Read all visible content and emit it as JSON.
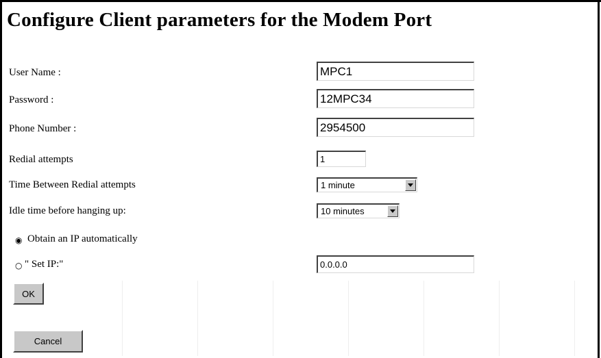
{
  "page": {
    "title": "Configure Client parameters for the Modem Port"
  },
  "form": {
    "user_name": {
      "label": "User Name :",
      "value": "MPC1"
    },
    "password": {
      "label": "Password :",
      "value": "12MPC34"
    },
    "phone_number": {
      "label": "Phone Number :",
      "value": "2954500"
    },
    "redial_attempts": {
      "label": "Redial attempts",
      "value": "1"
    },
    "time_between_redial": {
      "label": "Time Between Redial attempts",
      "selected": "1 minute"
    },
    "idle_time": {
      "label": "Idle time before hanging up:",
      "selected": "10 minutes"
    },
    "obtain_ip": {
      "label": "Obtain an IP automatically",
      "checked": true
    },
    "set_ip": {
      "label": "\" Set IP:\"",
      "value": "0.0.0.0",
      "checked": false
    }
  },
  "buttons": {
    "ok_label": "OK",
    "cancel_label": "Cancel"
  },
  "icons": {
    "radio_selected": "radio-selected-icon",
    "radio_unselected": "radio-unselected-icon",
    "dropdown_arrow": "chevron-down-icon"
  }
}
